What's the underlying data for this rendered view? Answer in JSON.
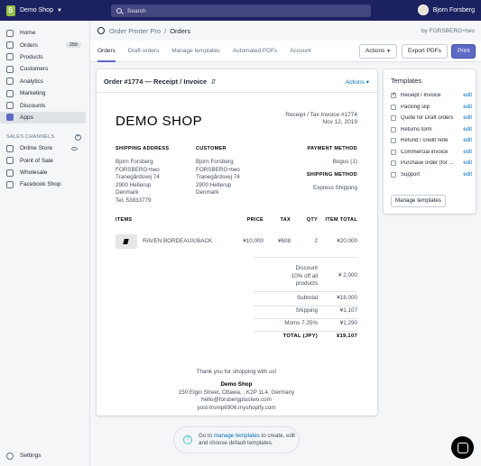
{
  "topbar": {
    "store_name": "Demo Shop",
    "search_placeholder": "Search",
    "user_name": "Bjorn Forsberg"
  },
  "sidebar": {
    "items": [
      {
        "label": "Home"
      },
      {
        "label": "Orders",
        "badge": "259"
      },
      {
        "label": "Products"
      },
      {
        "label": "Customers"
      },
      {
        "label": "Analytics"
      },
      {
        "label": "Marketing"
      },
      {
        "label": "Discounts"
      },
      {
        "label": "Apps"
      }
    ],
    "channels_heading": "SALES CHANNELS",
    "channels": [
      {
        "label": "Online Store"
      },
      {
        "label": "Point of Sale"
      },
      {
        "label": "Wholesale"
      },
      {
        "label": "Facebook Shop"
      }
    ],
    "settings_label": "Settings"
  },
  "apphead": {
    "app_name": "Order Printer Pro",
    "separator": "/",
    "page": "Orders",
    "by": "by FORSBERG+two"
  },
  "tabs": [
    "Orders",
    "Draft orders",
    "Manage templates",
    "Automated PDFs",
    "Account"
  ],
  "toolbar": {
    "actions": "Actions",
    "export": "Export PDFs",
    "print": "Print"
  },
  "order": {
    "title": "Order #1774 — Receipt / Invoice",
    "switch_icon": "⇵",
    "actions": "Actions ▾"
  },
  "doc": {
    "shop_title": "DEMO SHOP",
    "invoice_label": "Receipt / Tax Invoice #1774",
    "invoice_date": "Nov 12, 2019",
    "shipping_address_label": "SHIPPING ADDRESS",
    "shipping_address": [
      "Bjorn Forsberg",
      "FORSBERG+two",
      "Tranegårdsvej 74",
      "2900 Hellerup",
      "Denmark",
      "Tel. 53833779"
    ],
    "customer_label": "CUSTOMER",
    "customer": [
      "Bjorn Forsberg",
      "FORSBERG+two",
      "Tranegårdsvej 74",
      "2900 Hellerup",
      "Denmark"
    ],
    "payment_label": "PAYMENT METHOD",
    "payment": "Bogus (1)",
    "shipping_method_label": "SHIPPING METHOD",
    "shipping_method": "Express Shipping",
    "items_label": "ITEMS",
    "price_label": "PRICE",
    "tax_label": "TAX",
    "qty_label": "QTY",
    "item_total_label": "ITEM TOTAL",
    "item": {
      "name": "RAVEN BORDEAUX/BACK",
      "price": "¥10,000",
      "tax": "¥608",
      "qty": "2",
      "total": "¥20,000"
    },
    "discount_label": [
      "Discount",
      "10% off all",
      "products"
    ],
    "discount": "¥ 2,000",
    "subtotal_label": "Subtotal",
    "subtotal": "¥18,000",
    "shipping_label": "Shipping",
    "shipping": "¥1,107",
    "moms_label": "Moms 7.25%",
    "moms": "¥1,290",
    "total_label": "TOTAL (JPY)",
    "total": "¥19,107",
    "thanks": "Thank you for shopping with us!",
    "footer_shop": "Demo Shop",
    "footer_address": "150 Elgin Street, Ottawa, , K2P 1L4, Germany",
    "footer_email": "hello@forsbergplustwo.com",
    "footer_domain": "yost-tromp6906.myshopify.com"
  },
  "templates": {
    "heading": "Templates",
    "items": [
      {
        "name": "Receipt / Invoice",
        "checked": true
      },
      {
        "name": "Packing slip",
        "checked": false
      },
      {
        "name": "Quote for Draft orders",
        "checked": false
      },
      {
        "name": "Returns form",
        "checked": false
      },
      {
        "name": "Refund / credit note",
        "checked": false
      },
      {
        "name": "Commercial invoice",
        "checked": false
      },
      {
        "name": "Purchase order (for ...",
        "checked": false
      },
      {
        "name": "Support",
        "checked": false
      }
    ],
    "edit_label": "edit",
    "manage_button": "Manage templates"
  },
  "help": {
    "prefix": "Go to ",
    "link": "manage templates",
    "suffix": " to create, edit and choose default templates."
  },
  "colors": {
    "topbar": "#1c2260",
    "accent": "#5c6ac4",
    "link": "#006fbb"
  }
}
